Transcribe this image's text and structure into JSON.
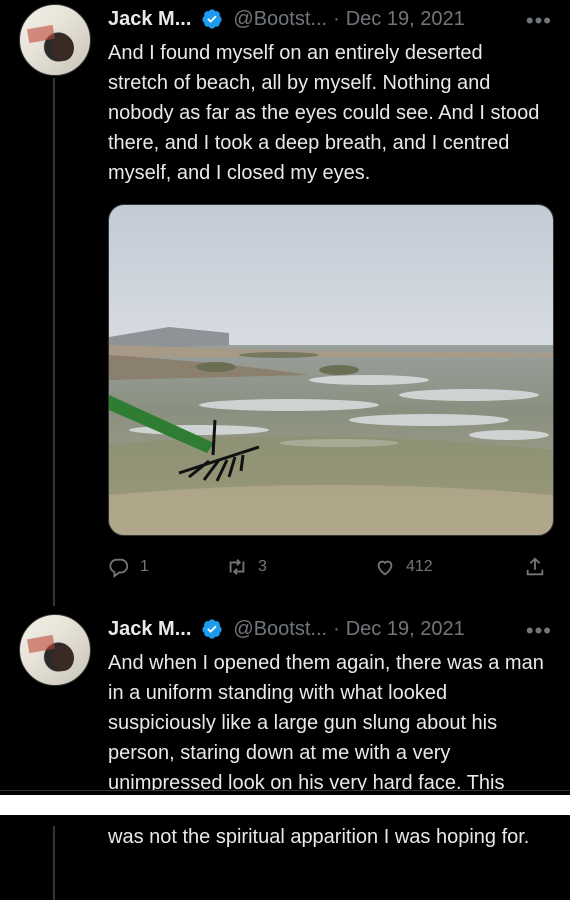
{
  "tweets": [
    {
      "name": "Jack M...",
      "handle": "@Bootst...",
      "separator": "·",
      "date": "Dec 19, 2021",
      "more": "•••",
      "text": "And I found myself on an entirely deserted stretch of beach, all by myself. Nothing and nobody as far as the eyes could see. And I stood there, and I took a deep breath, and I centred myself, and I closed my eyes.",
      "replies": "1",
      "retweets": "3",
      "likes": "412"
    },
    {
      "name": "Jack M...",
      "handle": "@Bootst...",
      "separator": "·",
      "date": "Dec 19, 2021",
      "more": "•••",
      "text": "And when I opened them again, there was a man in a uniform standing with what looked suspiciously like a large gun slung about his person, staring down at me with a very unimpressed look on his very hard face. This"
    }
  ],
  "continuation": "was not the spiritual apparition I was hoping for.",
  "colors": {
    "background": "#000000",
    "text": "#e7e9ea",
    "muted": "#71767b",
    "verified": "#1d9bf0"
  },
  "icons": [
    "reply-icon",
    "retweet-icon",
    "like-icon",
    "share-icon",
    "verified-icon"
  ]
}
